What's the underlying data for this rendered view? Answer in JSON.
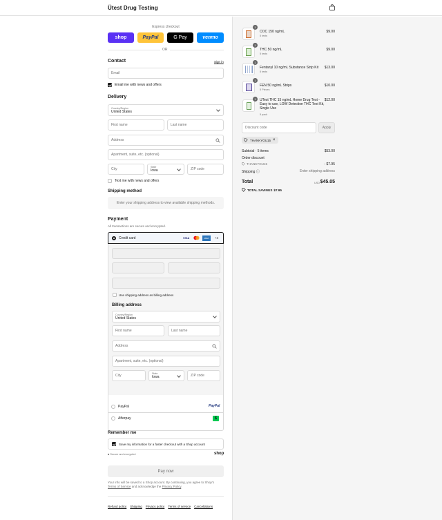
{
  "header": {
    "brand": "Ütest Drug Testing",
    "cart_icon": "shopping-bag-icon"
  },
  "express": {
    "title": "Express checkout",
    "buttons": [
      {
        "label": "shop",
        "color": "#5a31f4"
      },
      {
        "label": "PayPal",
        "color": "#ffc439"
      },
      {
        "label": "G Pay",
        "color": "#000000"
      },
      {
        "label": "venmo",
        "color": "#008cff"
      }
    ],
    "or": "OR"
  },
  "contact": {
    "title": "Contact",
    "sign_in": "Sign in",
    "email_placeholder": "Email",
    "news_label": "Email me with news and offers"
  },
  "delivery": {
    "title": "Delivery",
    "country_label": "Country/Region",
    "country_value": "United States",
    "first_name": "First name",
    "last_name": "Last name",
    "address": "Address",
    "apartment": "Apartment, suite, etc. (optional)",
    "city": "City",
    "state_label": "State",
    "state_value": "Iowa",
    "zip": "ZIP code",
    "text_label": "Text me with news and offers"
  },
  "shipping_method": {
    "title": "Shipping method",
    "note": "Enter your shipping address to view available shipping methods."
  },
  "payment": {
    "title": "Payment",
    "subtitle": "All transactions are secure and encrypted.",
    "credit_card": "Credit card",
    "card_brands": [
      "VISA",
      "MC",
      "AMEX"
    ],
    "more_brands": "+4",
    "use_shipping": "Use shipping address as billing address",
    "billing_title": "Billing address",
    "billing": {
      "country_label": "Country/Region",
      "country_value": "United States",
      "first_name": "First name",
      "last_name": "Last name",
      "address": "Address",
      "apartment": "Apartment, suite, etc. (optional)",
      "city": "City",
      "state_label": "State",
      "state_value": "Iowa",
      "zip": "ZIP code"
    },
    "paypal": "PayPal",
    "paypal_logo": "PayPal",
    "afterpay": "Afterpay",
    "afterpay_logo": "$"
  },
  "remember": {
    "title": "Remember me",
    "save_label": "Save my information for a faster checkout with a Shop account",
    "secure": "Secure and encrypted",
    "shop_logo": "shop"
  },
  "pay_button": "Pay now",
  "legal": {
    "line1": "Your info will be saved to a Shop account. By continuing, you agree to Shop's",
    "tos": "Terms of Service",
    "and_ack": "and acknowledge the",
    "privacy": "Privacy Policy",
    "period": "."
  },
  "footer_links": [
    "Refund policy",
    "Shipping",
    "Privacy policy",
    "Terms of service",
    "Cancellations"
  ],
  "cart": {
    "items": [
      {
        "qty": "1",
        "name": "COC 150 ng/mL",
        "sub": "5 tests",
        "price": "$9.00"
      },
      {
        "qty": "1",
        "name": "THC 50 ng/mL",
        "sub": "5 tests",
        "price": "$9.00"
      },
      {
        "qty": "1",
        "name": "Fentanyl 10 ng/mL Substance Strip Kit",
        "sub": "5 tests",
        "price": "$13.00"
      },
      {
        "qty": "1",
        "name": "FEN 50 ng/mL Strips",
        "sub": "5 Pieces",
        "price": "$10.00"
      },
      {
        "qty": "1",
        "name_lines": [
          "UTest THC 15 ng/mL Home Drug Test -",
          "Easy to use, LOW Detection THC Test Kit,",
          "Single Use"
        ],
        "sub": "5 pack",
        "price": "$12.00"
      }
    ],
    "discount_placeholder": "Discount code",
    "apply": "Apply",
    "applied_code": "THANKYOU15",
    "subtotal_label": "Subtotal · 5 items",
    "subtotal_value": "$53.00",
    "order_discount": "Order discount",
    "discount_code": "THANKYOU15",
    "discount_value": "- $7.95",
    "shipping_label": "Shipping",
    "shipping_value": "Enter shipping address",
    "total_label": "Total",
    "currency": "USD",
    "total_value": "$45.05",
    "savings_label": "TOTAL SAVINGS",
    "savings_value": "$7.95"
  }
}
